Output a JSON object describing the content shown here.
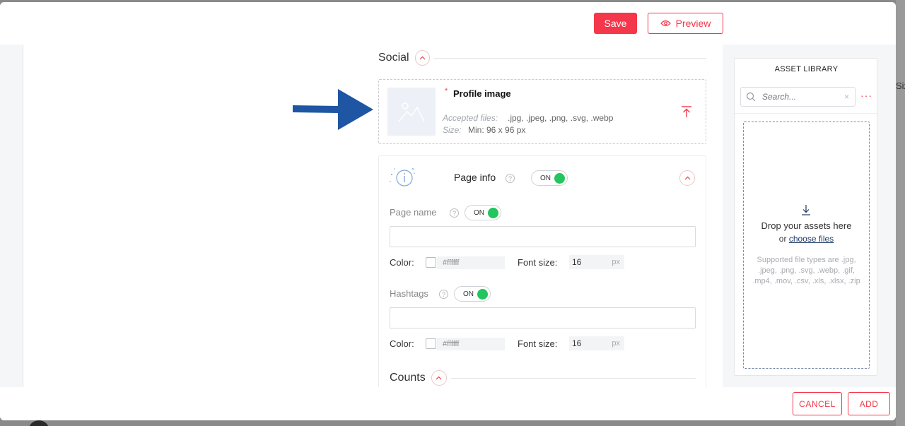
{
  "toolbar": {
    "save_label": "Save",
    "preview_label": "Preview"
  },
  "social": {
    "title": "Social",
    "profile_image": {
      "required_mark": "*",
      "label": "Profile image",
      "accepted_label": "Accepted files:",
      "accepted_value": ".jpg, .jpeg, .png, .svg, .webp",
      "size_label": "Size:",
      "size_value": "Min: 96 x 96 px"
    }
  },
  "page_info": {
    "title": "Page info",
    "help": "?",
    "toggle": "ON",
    "page_name": {
      "label": "Page name",
      "toggle": "ON",
      "value": "",
      "color_label": "Color:",
      "color_value": "#ffffff",
      "font_size_label": "Font size:",
      "font_size_value": "16",
      "font_size_unit": "px"
    },
    "hashtags": {
      "label": "Hashtags",
      "toggle": "ON",
      "value": "",
      "color_label": "Color:",
      "color_value": "#ffffff",
      "font_size_label": "Font size:",
      "font_size_value": "16",
      "font_size_unit": "px"
    }
  },
  "counts": {
    "title": "Counts"
  },
  "asset_library": {
    "title": "ASSET LIBRARY",
    "search_placeholder": "Search...",
    "clear": "×",
    "more": "···",
    "drop_title": "Drop your assets here",
    "drop_or": "or",
    "choose_files": "choose files",
    "supported": "Supported file types are .jpg, .jpeg, .png, .svg, .webp, .gif, .mp4, .mov, .csv, .xls, .xlsx, .zip"
  },
  "footer": {
    "cancel_label": "CANCEL",
    "add_label": "ADD"
  },
  "backdrop": {
    "side_text": "Siz"
  },
  "colors": {
    "accent": "#f4374a",
    "toggle_on": "#22c55e",
    "arrow": "#1f56a3"
  }
}
